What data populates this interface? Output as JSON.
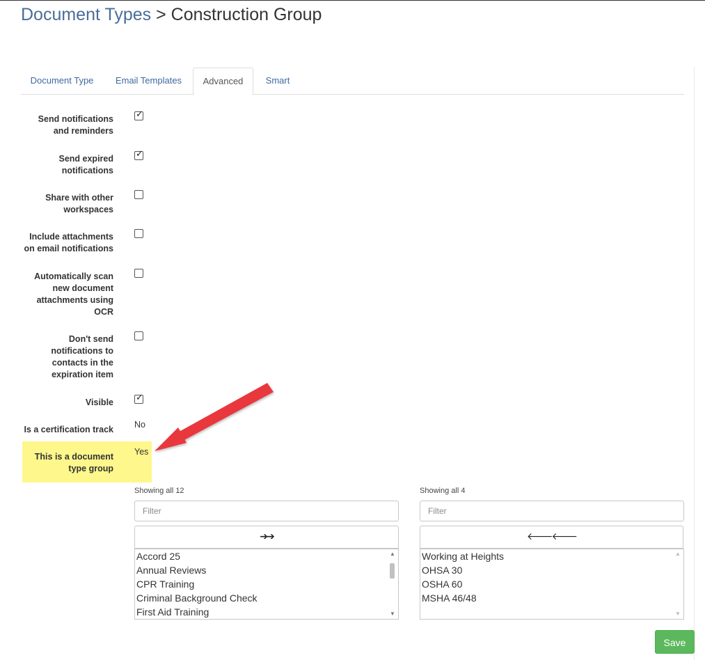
{
  "header": {
    "breadcrumb_link": "Document Types",
    "separator": ">",
    "current": "Construction Group"
  },
  "tabs": [
    {
      "label": "Document Type",
      "active": false
    },
    {
      "label": "Email Templates",
      "active": false
    },
    {
      "label": "Advanced",
      "active": true
    },
    {
      "label": "Smart",
      "active": false
    }
  ],
  "fields": {
    "send_notifications": {
      "label": "Send notifications and reminders",
      "checked": true
    },
    "send_expired": {
      "label": "Send expired notifications",
      "checked": true
    },
    "share_workspaces": {
      "label": "Share with other workspaces",
      "checked": false
    },
    "include_attachments": {
      "label": "Include attachments on email notifications",
      "checked": false
    },
    "auto_scan_ocr": {
      "label": "Automatically scan new document attachments using OCR",
      "checked": false
    },
    "dont_send_contacts": {
      "label": "Don't send notifications to contacts in the expiration item",
      "checked": false
    },
    "visible": {
      "label": "Visible",
      "checked": true
    },
    "certification_track": {
      "label": "Is a certification track",
      "value": "No"
    },
    "document_type_group": {
      "label": "This is a document type group",
      "value": "Yes"
    }
  },
  "dual_list": {
    "available": {
      "count_text": "Showing all 12",
      "filter_placeholder": "Filter",
      "move_label": "➔➔",
      "items": [
        "Accord 25",
        "Annual Reviews",
        "CPR Training",
        "Criminal Background Check",
        "First Aid Training"
      ]
    },
    "selected": {
      "count_text": "Showing all 4",
      "filter_placeholder": "Filter",
      "move_label": "🡐🡐",
      "items": [
        "Working at Heights",
        "OHSA 30",
        "OSHA 60",
        "MSHA 46/48"
      ]
    }
  },
  "actions": {
    "save_label": "Save"
  },
  "colors": {
    "link": "#4a6d99",
    "highlight": "#fdf78c",
    "save_button": "#5cb85c",
    "arrow": "#e8383d"
  },
  "icons": {
    "checkbox_check": "check-icon",
    "annotation_arrow": "red-arrow-icon"
  }
}
